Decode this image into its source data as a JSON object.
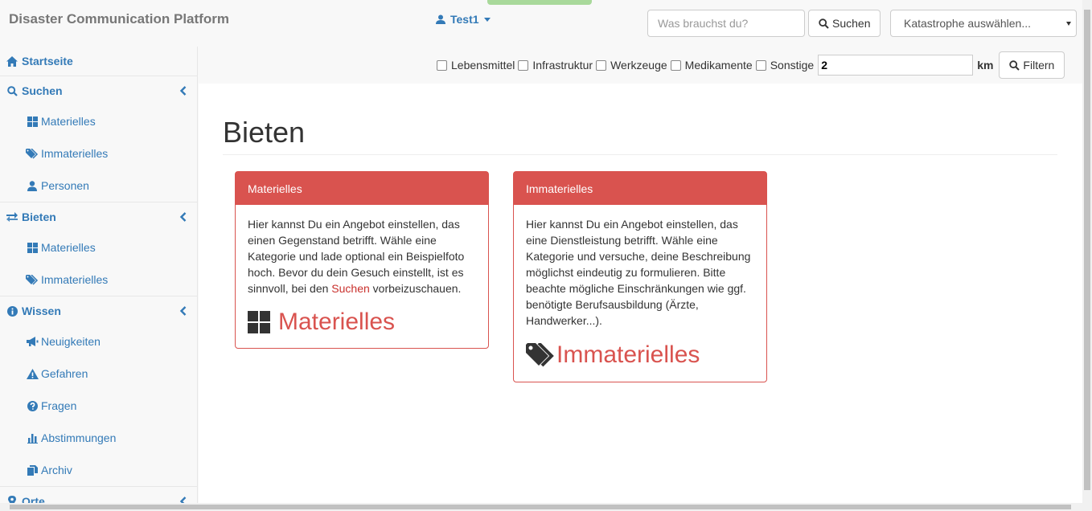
{
  "navbar": {
    "brand": "Disaster Communication Platform",
    "user": "Test1",
    "search_placeholder": "Was brauchst du?",
    "search_button": "Suchen",
    "disaster_select": "Katastrophe auswählen..."
  },
  "filters": {
    "items": [
      "Lebensmittel",
      "Infrastruktur",
      "Werkzeuge",
      "Medikamente",
      "Sonstige"
    ],
    "distance_value": "2",
    "distance_unit": "km",
    "filter_button": "Filtern"
  },
  "sidebar": {
    "home": "Startseite",
    "search": {
      "label": "Suchen",
      "items": [
        "Materielles",
        "Immaterielles",
        "Personen"
      ]
    },
    "offer": {
      "label": "Bieten",
      "items": [
        "Materielles",
        "Immaterielles"
      ]
    },
    "knowledge": {
      "label": "Wissen",
      "items": [
        "Neuigkeiten",
        "Gefahren",
        "Fragen",
        "Abstimmungen",
        "Archiv"
      ]
    },
    "places": {
      "label": "Orte"
    }
  },
  "main": {
    "title": "Bieten",
    "material": {
      "heading": "Materielles",
      "text_before": "Hier kannst Du ein Angebot einstellen, das einen Gegenstand betrifft. Wähle eine Kategorie und lade optional ein Beispielfoto hoch. Bevor du dein Gesuch einstellt, ist es sinnvoll, bei den ",
      "link": "Suchen",
      "text_after": " vorbeizuschauen.",
      "big_link": "Materielles"
    },
    "immaterial": {
      "heading": "Immaterielles",
      "text": "Hier kannst Du ein Angebot einstellen, das eine Dienstleistung betrifft. Wähle eine Kategorie und versuche, deine Beschreibung möglichst eindeutig zu formulieren. Bitte beachte mögliche Einschränkungen wie ggf. benötigte Berufsausbildung (Ärzte, Handwerker...).",
      "big_link": "Immaterielles"
    }
  },
  "colors": {
    "primary": "#337ab7",
    "danger": "#d9534f"
  },
  "icons": {
    "home": "home-icon",
    "search": "search-icon",
    "grid": "th-large-icon",
    "tags": "tags-icon",
    "user": "user-icon",
    "transfer": "transfer-icon",
    "info": "info-sign-icon",
    "bullhorn": "bullhorn-icon",
    "warning": "warning-sign-icon",
    "question": "question-sign-icon",
    "stats": "stats-icon",
    "archive": "duplicate-icon",
    "marker": "map-marker-icon",
    "chevron": "chevron-left-icon"
  }
}
